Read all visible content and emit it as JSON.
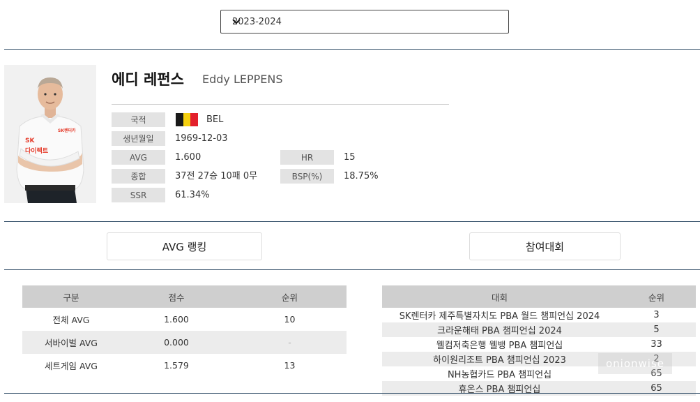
{
  "season_select": {
    "selected": "2023-2024"
  },
  "player": {
    "name_ko": "에디 레펀스",
    "name_en": "Eddy LEPPENS",
    "flag_colors": [
      "#1a1a1a",
      "#f5d010",
      "#e3202c"
    ],
    "fields": {
      "nationality": {
        "label": "국적",
        "value": "BEL"
      },
      "birth": {
        "label": "생년월일",
        "value": "1969-12-03"
      },
      "avg": {
        "label": "AVG",
        "value": "1.600"
      },
      "hr": {
        "label": "HR",
        "value": "15"
      },
      "record": {
        "label": "종합",
        "value": "37전 27승 10패 0무"
      },
      "bsp": {
        "label": "BSP(%)",
        "value": "18.75%"
      },
      "ssr": {
        "label": "SSR",
        "value": "61.34%"
      }
    },
    "shirt_text": {
      "brand": "SK",
      "sub": "다이렉트"
    }
  },
  "tabs": {
    "avg_ranking": "AVG 랭킹",
    "tournaments": "참여대회"
  },
  "avg_table": {
    "headers": [
      "구분",
      "점수",
      "순위"
    ],
    "rows": [
      [
        "전체 AVG",
        "1.600",
        "10"
      ],
      [
        "서바이벌 AVG",
        "0.000",
        "-"
      ],
      [
        "세트게임 AVG",
        "1.579",
        "13"
      ]
    ]
  },
  "tournament_table": {
    "headers": [
      "대회",
      "순위"
    ],
    "rows": [
      [
        "SK렌터카 제주특별자치도 PBA 월드 챔피언십 2024",
        "3"
      ],
      [
        "크라운해태 PBA 챔피언십 2024",
        "5"
      ],
      [
        "웰컴저축은행 웰뱅 PBA 챔피언십",
        "33"
      ],
      [
        "하이원리조트 PBA 챔피언십 2023",
        "2"
      ],
      [
        "NH농협카드 PBA 챔피언십",
        "65"
      ],
      [
        "휴온스 PBA 챔피언십",
        "65"
      ]
    ]
  },
  "watermark": "onionwise"
}
